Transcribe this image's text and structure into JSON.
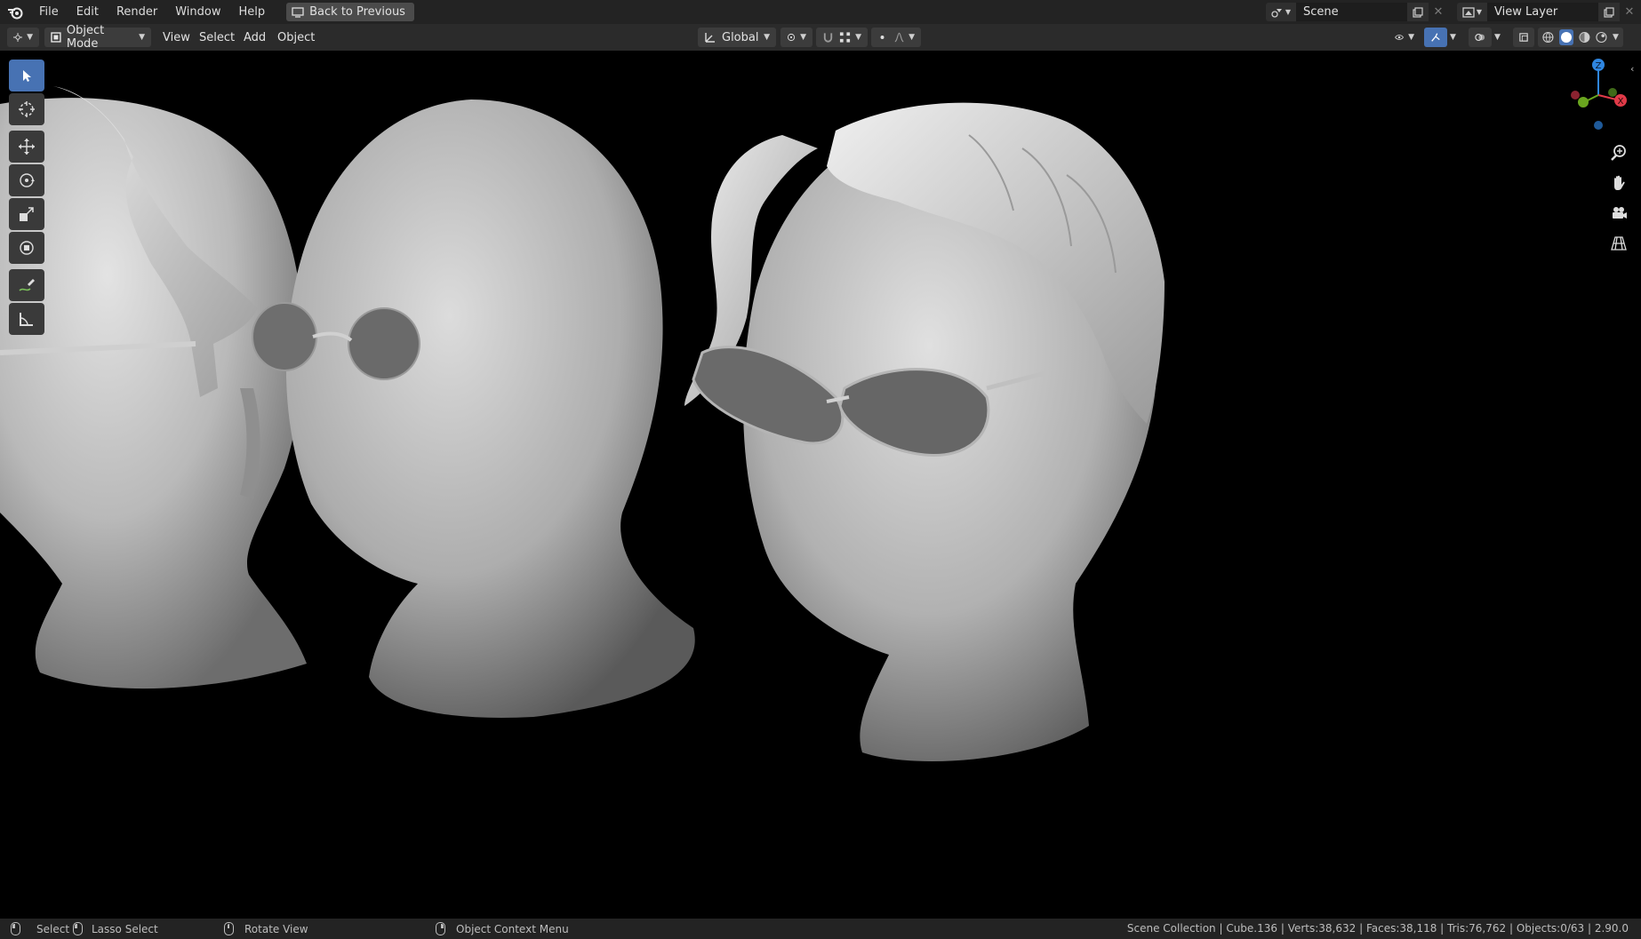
{
  "menu": {
    "items": [
      "File",
      "Edit",
      "Render",
      "Window",
      "Help"
    ],
    "back_button": "Back to Previous"
  },
  "scene": {
    "name": "Scene",
    "view_layer": "View Layer"
  },
  "header": {
    "mode": "Object Mode",
    "menus": [
      "View",
      "Select",
      "Add",
      "Object"
    ],
    "orientation": "Global"
  },
  "statusbar": {
    "select": "Select",
    "lasso": "Lasso Select",
    "rotate": "Rotate View",
    "context": "Object Context Menu",
    "stats": "Scene Collection | Cube.136 | Verts:38,632 | Faces:38,118 | Tris:76,762 | Objects:0/63 | 2.90.0"
  },
  "gizmo": {
    "z": "Z",
    "x": "X",
    "y": "Y"
  },
  "colors": {
    "accent": "#4772b3",
    "axis_x": "#e03a48",
    "axis_y": "#6aa61f",
    "axis_z": "#2f86e0"
  }
}
